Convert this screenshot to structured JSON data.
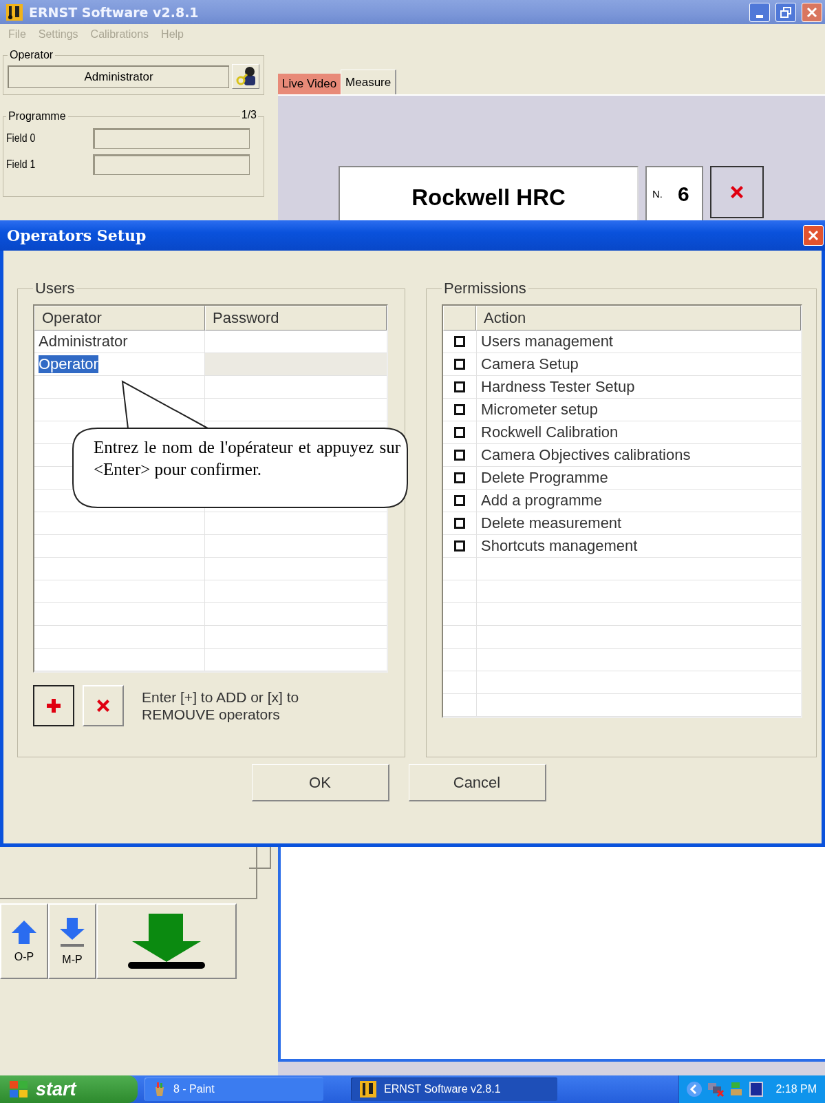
{
  "window": {
    "title": "ERNST Software v2.8.1"
  },
  "menu": [
    {
      "label": "File",
      "disabled": true
    },
    {
      "label": "Settings",
      "disabled": true
    },
    {
      "label": "Calibrations",
      "disabled": true
    },
    {
      "label": "Help",
      "disabled": true
    }
  ],
  "operator_panel": {
    "title": "Operator",
    "value": "Administrator"
  },
  "programme_panel": {
    "title": "Programme",
    "counter": "1/3",
    "fields": [
      {
        "label": "Field 0"
      },
      {
        "label": "Field 1"
      }
    ]
  },
  "tabs": [
    {
      "label": "Live Video",
      "selected": false
    },
    {
      "label": "Measure",
      "selected": true
    }
  ],
  "measure": {
    "method": "Rockwell HRC",
    "count_label": "N.",
    "count": "6"
  },
  "shortcut_buttons": [
    {
      "kind": "up",
      "label": "O-P"
    },
    {
      "kind": "down",
      "label": "M-P"
    },
    {
      "kind": "download"
    }
  ],
  "dialog": {
    "title": "Operators Setup",
    "users": {
      "title": "Users",
      "columns": [
        "Operator",
        "Password"
      ],
      "rows": [
        {
          "operator": "Administrator",
          "selected": false
        },
        {
          "operator": "Operator",
          "selected": true
        }
      ]
    },
    "hint": "Enter [+] to ADD or [x] to REMOUVE operators",
    "permissions": {
      "title": "Permissions",
      "columns": [
        "Action"
      ],
      "rows": [
        {
          "action": "Users management",
          "checked": false
        },
        {
          "action": "Camera Setup",
          "checked": false
        },
        {
          "action": "Hardness Tester Setup",
          "checked": false
        },
        {
          "action": "Micrometer setup",
          "checked": false
        },
        {
          "action": "Rockwell Calibration",
          "checked": false
        },
        {
          "action": "Camera Objectives calibrations",
          "checked": false
        },
        {
          "action": "Delete Programme",
          "checked": false
        },
        {
          "action": "Add a programme",
          "checked": false
        },
        {
          "action": "Delete measurement",
          "checked": false
        },
        {
          "action": "Shortcuts management",
          "checked": false
        }
      ]
    },
    "buttons": [
      "OK",
      "Cancel"
    ],
    "callout": "Entrez le nom de l'opérateur et appuyez sur <Enter> pour confirmer."
  },
  "taskbar": {
    "start": "start",
    "tasks": [
      {
        "label": "8 - Paint",
        "selected": false
      },
      {
        "label": "ERNST Software v2.8.1",
        "selected": true
      }
    ],
    "clock": "2:18 PM"
  }
}
